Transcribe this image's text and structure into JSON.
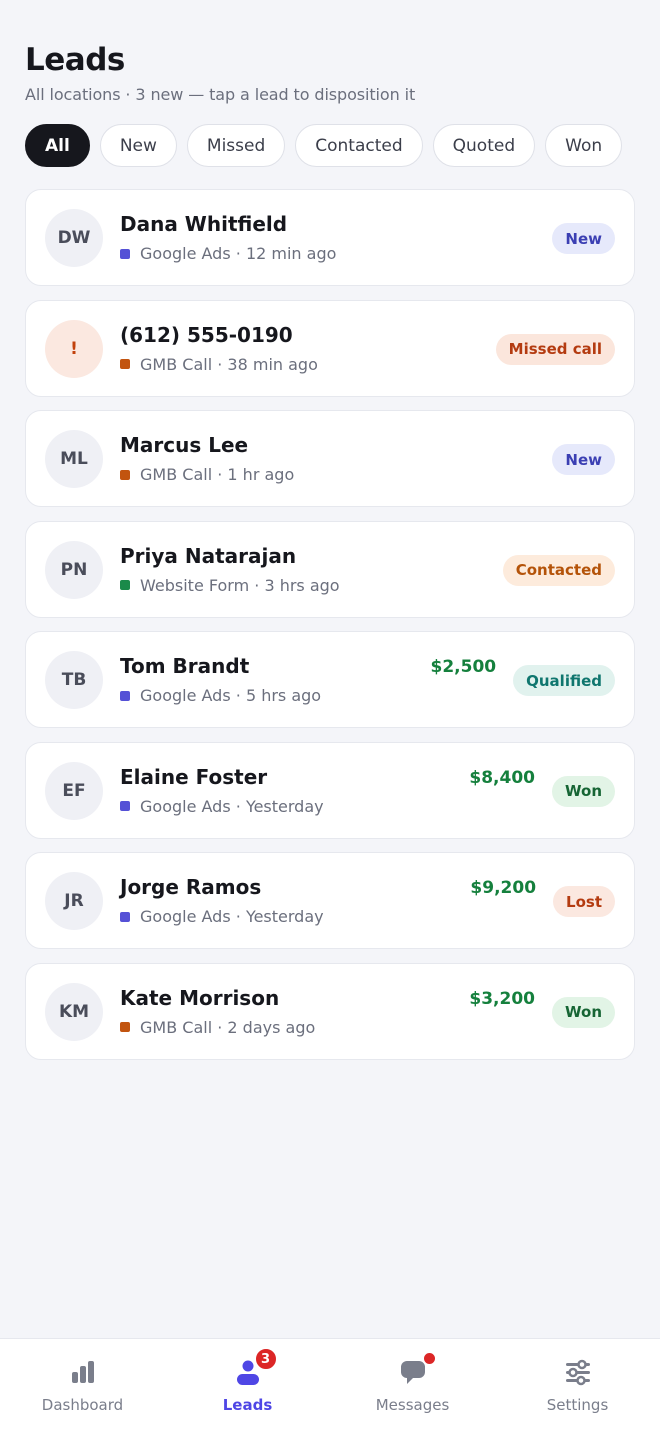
{
  "header": {
    "title": "Leads",
    "subtitle": "All locations · 3 new — tap a lead to disposition it"
  },
  "filters": [
    {
      "label": "All",
      "active": true
    },
    {
      "label": "New",
      "active": false
    },
    {
      "label": "Missed",
      "active": false
    },
    {
      "label": "Contacted",
      "active": false
    },
    {
      "label": "Quoted",
      "active": false
    },
    {
      "label": "Won",
      "active": false
    }
  ],
  "leads": [
    {
      "initials": "DW",
      "name": "Dana Whitfield",
      "source": "Google Ads",
      "time": "12 min ago",
      "source_color": "#5551d6",
      "amount": "",
      "status": "New",
      "status_bg": "#e6e9fb",
      "status_fg": "#3b3fb3",
      "alert": false
    },
    {
      "initials": "!",
      "name": "(612) 555-0190",
      "source": "GMB Call",
      "time": "38 min ago",
      "source_color": "#c2540f",
      "amount": "",
      "status": "Missed call",
      "status_bg": "#fbe6dc",
      "status_fg": "#b43b10",
      "alert": true
    },
    {
      "initials": "ML",
      "name": "Marcus Lee",
      "source": "GMB Call",
      "time": "1 hr ago",
      "source_color": "#c2540f",
      "amount": "",
      "status": "New",
      "status_bg": "#e6e9fb",
      "status_fg": "#3b3fb3",
      "alert": false
    },
    {
      "initials": "PN",
      "name": "Priya Natarajan",
      "source": "Website Form",
      "time": "3 hrs ago",
      "source_color": "#1a8a4a",
      "amount": "",
      "status": "Contacted",
      "status_bg": "#fdebdc",
      "status_fg": "#b45309",
      "alert": false
    },
    {
      "initials": "TB",
      "name": "Tom Brandt",
      "source": "Google Ads",
      "time": "5 hrs ago",
      "source_color": "#5551d6",
      "amount": "$2,500",
      "status": "Qualified",
      "status_bg": "#e1f2ee",
      "status_fg": "#0f766e",
      "alert": false
    },
    {
      "initials": "EF",
      "name": "Elaine Foster",
      "source": "Google Ads",
      "time": "Yesterday",
      "source_color": "#5551d6",
      "amount": "$8,400",
      "status": "Won",
      "status_bg": "#e2f4e6",
      "status_fg": "#166534",
      "alert": false
    },
    {
      "initials": "JR",
      "name": "Jorge Ramos",
      "source": "Google Ads",
      "time": "Yesterday",
      "source_color": "#5551d6",
      "amount": "$9,200",
      "status": "Lost",
      "status_bg": "#fbe8e0",
      "status_fg": "#b43b10",
      "alert": false
    },
    {
      "initials": "KM",
      "name": "Kate Morrison",
      "source": "GMB Call",
      "time": "2 days ago",
      "source_color": "#c2540f",
      "amount": "$3,200",
      "status": "Won",
      "status_bg": "#e2f4e6",
      "status_fg": "#166534",
      "alert": false
    }
  ],
  "tabbar": {
    "accent": "#4f46e5",
    "items": [
      {
        "label": "Dashboard",
        "icon": "bar-chart-icon",
        "active": false,
        "badge": ""
      },
      {
        "label": "Leads",
        "icon": "user-icon",
        "active": true,
        "badge": "3"
      },
      {
        "label": "Messages",
        "icon": "chat-bubble-icon",
        "active": false,
        "badge": "dot"
      },
      {
        "label": "Settings",
        "icon": "sliders-icon",
        "active": false,
        "badge": ""
      }
    ]
  }
}
